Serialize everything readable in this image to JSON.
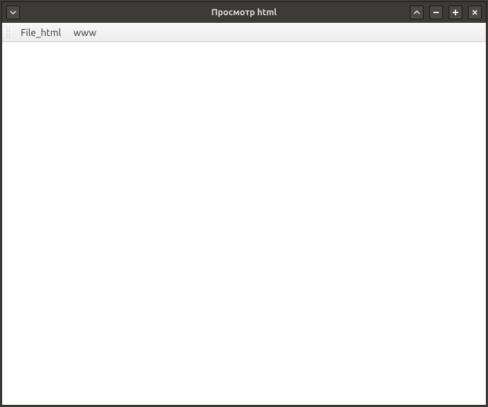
{
  "window": {
    "title": "Просмотр html"
  },
  "menu": {
    "items": [
      {
        "label": "File_html"
      },
      {
        "label": "www"
      }
    ]
  }
}
